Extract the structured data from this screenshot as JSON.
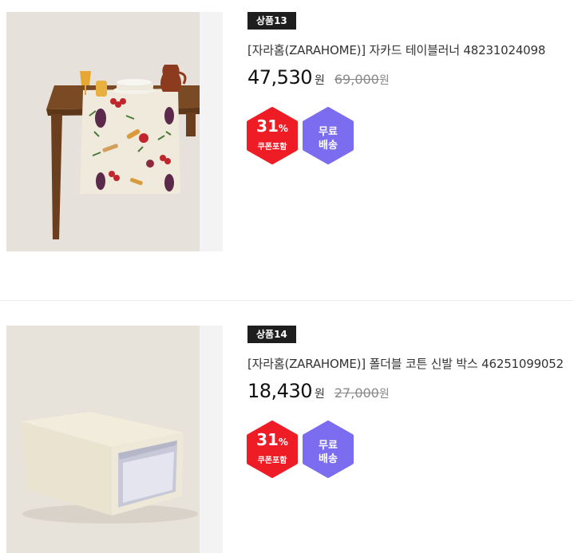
{
  "products": [
    {
      "badge": "상품13",
      "title": "[자라홈(ZARAHOME)] 자카드 테이블러너 48231024098",
      "sale_price": "47,530",
      "currency": "원",
      "original_price": "69,000",
      "discount_percent": "31",
      "percent_sign": "%",
      "coupon_label": "쿠폰포함",
      "shipping_line1": "무료",
      "shipping_line2": "배송",
      "image_desc": "table-runner"
    },
    {
      "badge": "상품14",
      "title": "[자라홈(ZARAHOME)] 폴더블 코튼 신발 박스 46251099052",
      "sale_price": "18,430",
      "currency": "원",
      "original_price": "27,000",
      "discount_percent": "31",
      "percent_sign": "%",
      "coupon_label": "쿠폰포함",
      "shipping_line1": "무료",
      "shipping_line2": "배송",
      "image_desc": "shoe-box"
    }
  ],
  "colors": {
    "badge_bg": "#1e1e1e",
    "coupon_red": "#ee1c25",
    "free_shipping_purple": "#7b6cf0",
    "strikethrough_gray": "#888888"
  }
}
